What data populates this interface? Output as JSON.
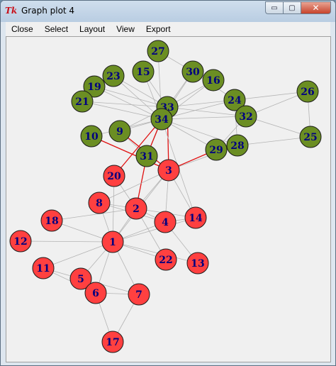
{
  "window": {
    "title": "Graph plot 4",
    "app_icon": "Tk",
    "controls": {
      "minimize": "▭",
      "maximize": "▢",
      "close": "✕"
    }
  },
  "menu": [
    {
      "id": "close",
      "label": "Close"
    },
    {
      "id": "select",
      "label": "Select"
    },
    {
      "id": "layout",
      "label": "Layout"
    },
    {
      "id": "view",
      "label": "View"
    },
    {
      "id": "export",
      "label": "Export"
    }
  ],
  "colors": {
    "red_node": "#ff4040",
    "green_node": "#6b8e23",
    "edge": "#b4b4b4",
    "highlight_edge": "#e01010",
    "label": "#00007f"
  },
  "graph": {
    "nodes": [
      {
        "id": "1",
        "group": "red"
      },
      {
        "id": "2",
        "group": "red"
      },
      {
        "id": "3",
        "group": "red"
      },
      {
        "id": "4",
        "group": "red"
      },
      {
        "id": "5",
        "group": "red"
      },
      {
        "id": "6",
        "group": "red"
      },
      {
        "id": "7",
        "group": "red"
      },
      {
        "id": "8",
        "group": "red"
      },
      {
        "id": "9",
        "group": "green"
      },
      {
        "id": "10",
        "group": "green"
      },
      {
        "id": "11",
        "group": "red"
      },
      {
        "id": "12",
        "group": "red"
      },
      {
        "id": "13",
        "group": "red"
      },
      {
        "id": "14",
        "group": "red"
      },
      {
        "id": "15",
        "group": "green"
      },
      {
        "id": "16",
        "group": "green"
      },
      {
        "id": "17",
        "group": "red"
      },
      {
        "id": "18",
        "group": "red"
      },
      {
        "id": "19",
        "group": "green"
      },
      {
        "id": "20",
        "group": "red"
      },
      {
        "id": "21",
        "group": "green"
      },
      {
        "id": "22",
        "group": "red"
      },
      {
        "id": "23",
        "group": "green"
      },
      {
        "id": "24",
        "group": "green"
      },
      {
        "id": "25",
        "group": "green"
      },
      {
        "id": "26",
        "group": "green"
      },
      {
        "id": "27",
        "group": "green"
      },
      {
        "id": "28",
        "group": "green"
      },
      {
        "id": "29",
        "group": "green"
      },
      {
        "id": "30",
        "group": "green"
      },
      {
        "id": "31",
        "group": "green"
      },
      {
        "id": "32",
        "group": "green"
      },
      {
        "id": "33",
        "group": "green"
      },
      {
        "id": "34",
        "group": "green"
      }
    ],
    "edges": [
      [
        "1",
        "2"
      ],
      [
        "1",
        "3"
      ],
      [
        "1",
        "4"
      ],
      [
        "1",
        "5"
      ],
      [
        "1",
        "6"
      ],
      [
        "1",
        "7"
      ],
      [
        "1",
        "8"
      ],
      [
        "1",
        "11"
      ],
      [
        "1",
        "12"
      ],
      [
        "1",
        "13"
      ],
      [
        "1",
        "14"
      ],
      [
        "1",
        "18"
      ],
      [
        "1",
        "20"
      ],
      [
        "1",
        "22"
      ],
      [
        "2",
        "3"
      ],
      [
        "2",
        "4"
      ],
      [
        "2",
        "8"
      ],
      [
        "2",
        "14"
      ],
      [
        "2",
        "18"
      ],
      [
        "2",
        "20"
      ],
      [
        "2",
        "22"
      ],
      [
        "2",
        "31"
      ],
      [
        "3",
        "4"
      ],
      [
        "3",
        "8"
      ],
      [
        "3",
        "9"
      ],
      [
        "3",
        "10"
      ],
      [
        "3",
        "14"
      ],
      [
        "3",
        "28"
      ],
      [
        "3",
        "29"
      ],
      [
        "3",
        "33"
      ],
      [
        "4",
        "8"
      ],
      [
        "4",
        "13"
      ],
      [
        "4",
        "14"
      ],
      [
        "5",
        "7"
      ],
      [
        "5",
        "11"
      ],
      [
        "6",
        "7"
      ],
      [
        "6",
        "11"
      ],
      [
        "6",
        "17"
      ],
      [
        "7",
        "17"
      ],
      [
        "9",
        "31"
      ],
      [
        "9",
        "33"
      ],
      [
        "9",
        "34"
      ],
      [
        "10",
        "34"
      ],
      [
        "14",
        "34"
      ],
      [
        "15",
        "33"
      ],
      [
        "15",
        "34"
      ],
      [
        "16",
        "33"
      ],
      [
        "16",
        "34"
      ],
      [
        "19",
        "33"
      ],
      [
        "19",
        "34"
      ],
      [
        "20",
        "34"
      ],
      [
        "21",
        "33"
      ],
      [
        "21",
        "34"
      ],
      [
        "23",
        "33"
      ],
      [
        "23",
        "34"
      ],
      [
        "24",
        "26"
      ],
      [
        "24",
        "28"
      ],
      [
        "24",
        "30"
      ],
      [
        "24",
        "33"
      ],
      [
        "24",
        "34"
      ],
      [
        "25",
        "26"
      ],
      [
        "25",
        "28"
      ],
      [
        "25",
        "32"
      ],
      [
        "26",
        "32"
      ],
      [
        "27",
        "30"
      ],
      [
        "27",
        "34"
      ],
      [
        "28",
        "34"
      ],
      [
        "29",
        "32"
      ],
      [
        "29",
        "34"
      ],
      [
        "30",
        "33"
      ],
      [
        "30",
        "34"
      ],
      [
        "31",
        "33"
      ],
      [
        "31",
        "34"
      ],
      [
        "32",
        "33"
      ],
      [
        "32",
        "34"
      ],
      [
        "33",
        "34"
      ]
    ],
    "highlighted_edges": [
      [
        "3",
        "9"
      ],
      [
        "3",
        "10"
      ],
      [
        "3",
        "29"
      ],
      [
        "3",
        "33"
      ],
      [
        "2",
        "31"
      ],
      [
        "20",
        "34"
      ],
      [
        "31",
        "34"
      ]
    ]
  }
}
